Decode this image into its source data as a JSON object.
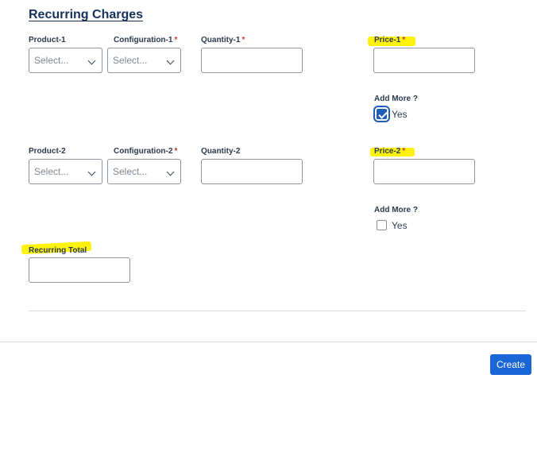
{
  "section_title": "Recurring Charges",
  "highlight_color": "#fff200",
  "row1": {
    "product_label": "Product-1",
    "product_value": "Select...",
    "config_label": "Configuration-1",
    "config_required": "*",
    "config_value": "Select...",
    "quantity_label": "Quantity-1",
    "quantity_required": "*",
    "quantity_value": "",
    "price_label": "Price-1",
    "price_required": "*",
    "price_value": "",
    "add_more_label": "Add More ?",
    "add_more_option": "Yes",
    "add_more_checked": true
  },
  "row2": {
    "product_label": "Product-2",
    "product_value": "Select...",
    "config_label": "Configuration-2",
    "config_required": "*",
    "config_value": "Select...",
    "quantity_label": "Quantity-2",
    "quantity_value": "",
    "price_label": "Price-2",
    "price_required": "*",
    "price_value": "",
    "add_more_label": "Add More ?",
    "add_more_option": "Yes",
    "add_more_checked": false
  },
  "recurring_total": {
    "label": "Recurring Total",
    "value": ""
  },
  "footer": {
    "create_label": "Create"
  }
}
